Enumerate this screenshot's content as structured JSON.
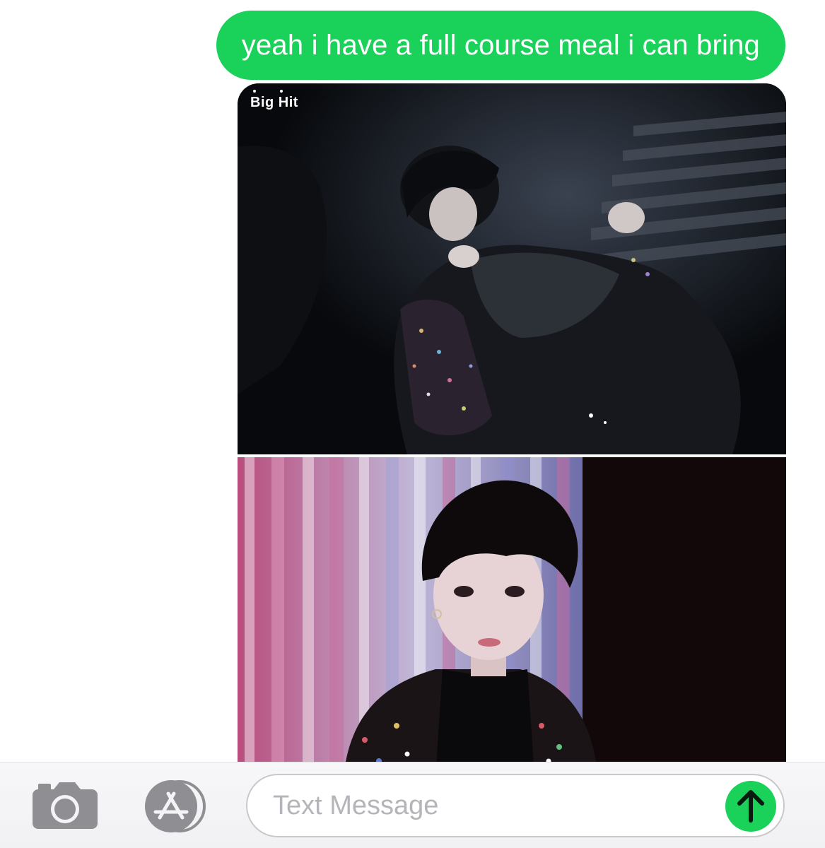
{
  "conversation": {
    "messages": [
      {
        "direction": "outgoing",
        "text": "yeah i have a full course meal i can bring"
      }
    ],
    "attachments": [
      {
        "kind": "photo",
        "watermark": "Big Hit"
      },
      {
        "kind": "photo"
      }
    ]
  },
  "input_bar": {
    "placeholder": "Text Message",
    "value": "",
    "camera_icon": "camera-icon",
    "appstore_icon": "app-store-icon",
    "send_icon": "send-arrow-up-icon"
  },
  "colors": {
    "bubble": "#1ad25a",
    "send_button": "#1ad25a",
    "icon_gray": "#8e8e93",
    "placeholder": "#b4b4b9"
  }
}
